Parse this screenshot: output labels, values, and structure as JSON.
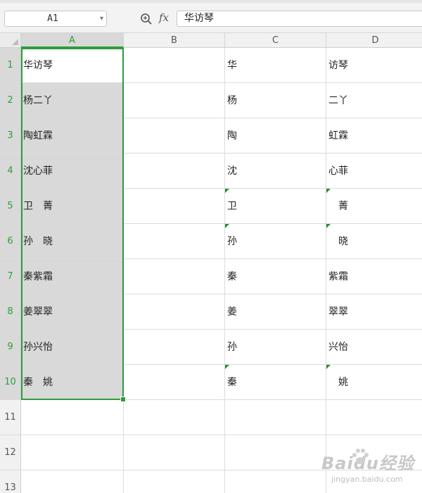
{
  "toolbar": {
    "name_box": "A1",
    "fx_label": "fx",
    "formula_value": "华访琴"
  },
  "columns": [
    "A",
    "B",
    "C",
    "D"
  ],
  "rows": [
    "1",
    "2",
    "3",
    "4",
    "5",
    "6",
    "7",
    "8",
    "9",
    "10",
    "11",
    "12",
    "13"
  ],
  "cells": {
    "A": [
      "华访琴",
      "杨二丫",
      "陶虹霖",
      "沈心菲",
      "卫　菁",
      "孙　晓",
      "秦紫霜",
      "姜翠翠",
      "孙兴怡",
      "秦　姚",
      "",
      "",
      ""
    ],
    "C": [
      "华",
      "杨",
      "陶",
      "沈",
      "卫",
      "孙",
      "秦",
      "姜",
      "孙",
      "秦",
      "",
      "",
      ""
    ],
    "D": [
      "访琴",
      "二丫",
      "虹霖",
      "心菲",
      "　菁",
      "　晓",
      "紫霜",
      "翠翠",
      "兴怡",
      "　姚",
      "",
      "",
      ""
    ]
  },
  "watermark": {
    "brand": "Baidu经验",
    "url": "jingyan.baidu.com"
  },
  "colors": {
    "selection_green": "#2e9c3a",
    "error_triangle": "#2e8b3a"
  },
  "icons": [
    "zoom-formula-icon",
    "dropdown-caret-icon"
  ]
}
